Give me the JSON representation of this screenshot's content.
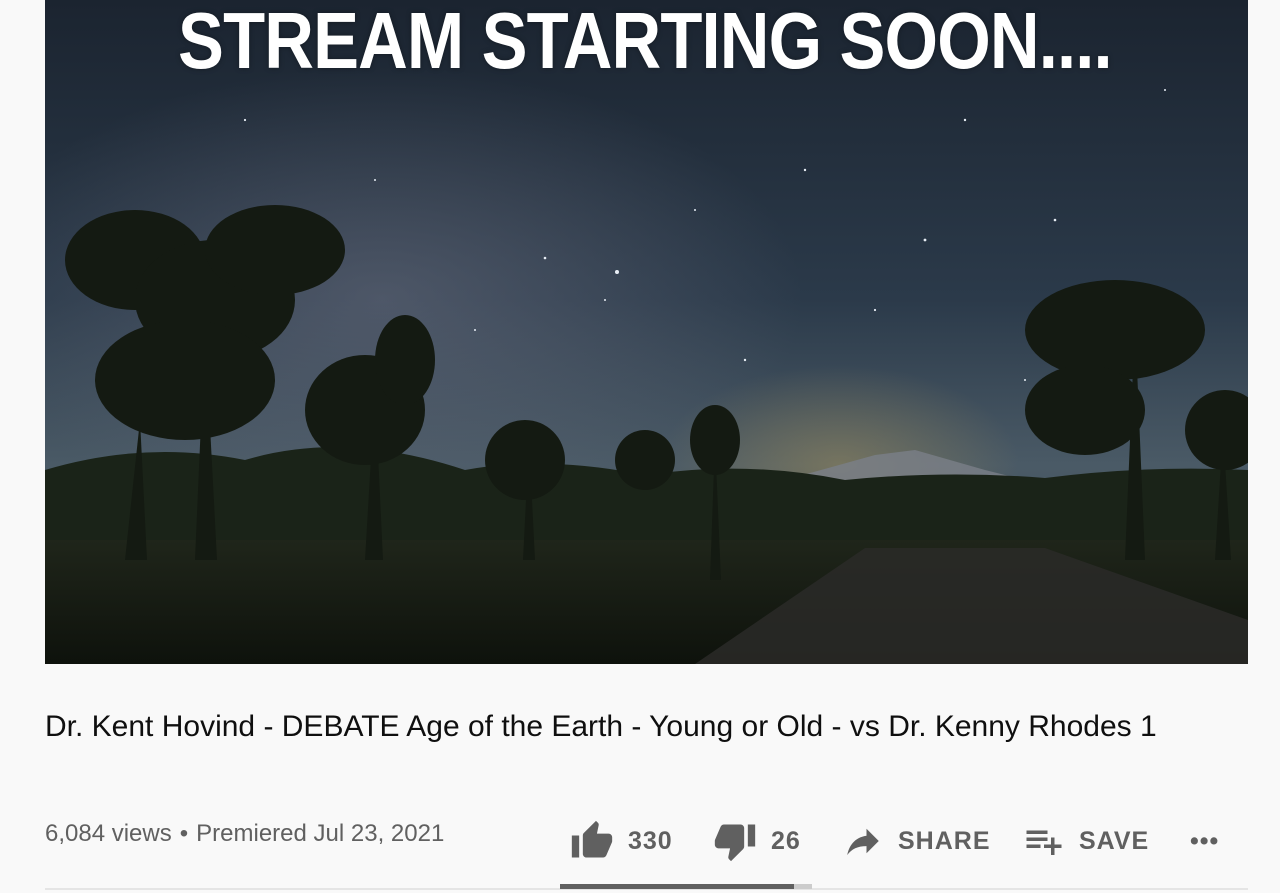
{
  "video": {
    "overlay_text": "STREAM STARTING SOON....",
    "title": "Dr. Kent Hovind - DEBATE Age of the Earth - Young or Old - vs Dr. Kenny Rhodes 1"
  },
  "meta": {
    "views": "6,084 views",
    "separator": "•",
    "premiered": "Premiered Jul 23, 2021"
  },
  "actions": {
    "like_count": "330",
    "dislike_count": "26",
    "share_label": "SHARE",
    "save_label": "SAVE",
    "more_label": "•••"
  },
  "sentiment": {
    "like_ratio": 0.927
  },
  "colors": {
    "page_background": "#f9f9f9",
    "text_primary": "#0f0f0f",
    "text_secondary": "#606060",
    "sentiment_track": "#cccccc",
    "sentiment_fill": "#606060"
  },
  "icons": {
    "like": "thumbs-up-icon",
    "dislike": "thumbs-down-icon",
    "share": "share-arrow-icon",
    "save": "playlist-add-icon",
    "more": "more-horizontal-icon"
  }
}
